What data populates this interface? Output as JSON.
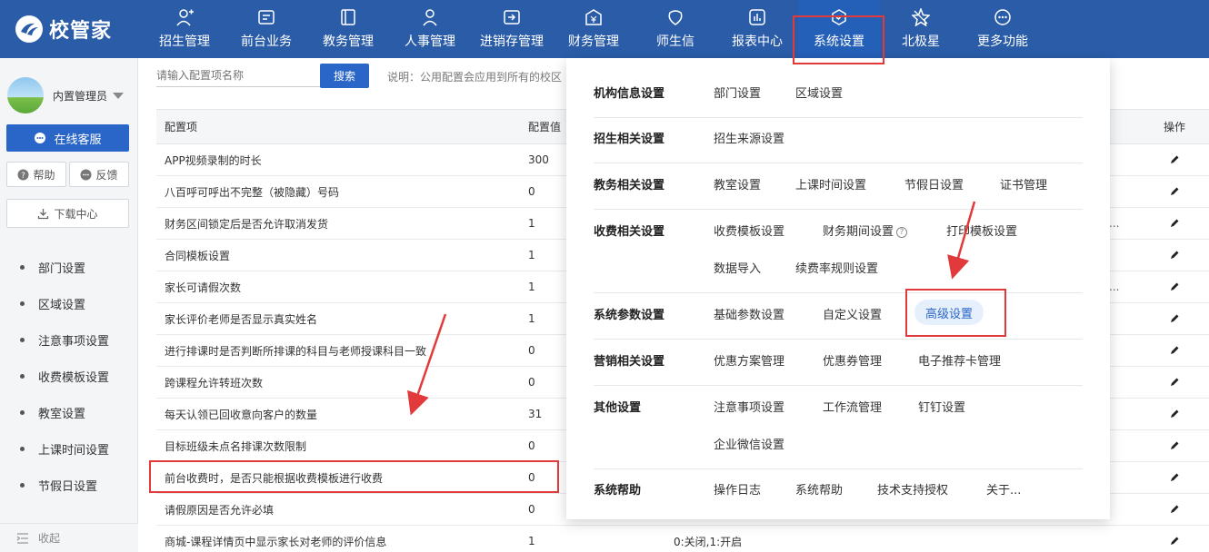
{
  "app": {
    "brand": "校管家"
  },
  "nav": [
    {
      "label": "招生管理",
      "icon": "user-add-icon"
    },
    {
      "label": "前台业务",
      "icon": "reception-icon"
    },
    {
      "label": "教务管理",
      "icon": "book-icon"
    },
    {
      "label": "人事管理",
      "icon": "person-icon"
    },
    {
      "label": "进销存管理",
      "icon": "inventory-icon"
    },
    {
      "label": "财务管理",
      "icon": "finance-icon"
    },
    {
      "label": "师生信",
      "icon": "message-icon"
    },
    {
      "label": "报表中心",
      "icon": "report-icon"
    },
    {
      "label": "系统设置",
      "icon": "settings-icon",
      "active": true
    },
    {
      "label": "北极星",
      "icon": "star-icon"
    },
    {
      "label": "更多功能",
      "icon": "more-icon"
    }
  ],
  "sidebar": {
    "username": "内置管理员",
    "online_service": "在线客服",
    "help": "帮助",
    "feedback": "反馈",
    "download": "下载中心",
    "items": [
      "部门设置",
      "区域设置",
      "注意事项设置",
      "收费模板设置",
      "教室设置",
      "上课时间设置",
      "节假日设置"
    ],
    "collapse": "收起"
  },
  "search": {
    "placeholder": "请输入配置项名称",
    "button": "搜索",
    "note": "说明：公用配置会应用到所有的校区"
  },
  "table": {
    "headers": {
      "name": "配置项",
      "value": "配置值",
      "op": "操作"
    },
    "rows": [
      {
        "name": "APP视频录制的时长",
        "value": "300",
        "desc": "",
        "extra": ""
      },
      {
        "name": "八百呼可呼出不完整（被隐藏）号码",
        "value": "0",
        "desc": "",
        "extra": ""
      },
      {
        "name": "财务区间锁定后是否允许取消发货",
        "value": "1",
        "desc": "",
        "extra": "..."
      },
      {
        "name": "合同模板设置",
        "value": "1",
        "desc": "",
        "extra": ""
      },
      {
        "name": "家长可请假次数",
        "value": "1",
        "desc": "",
        "extra": "..."
      },
      {
        "name": "家长评价老师是否显示真实姓名",
        "value": "1",
        "desc": "",
        "extra": ""
      },
      {
        "name": "进行排课时是否判断所排课的科目与老师授课科目一致",
        "value": "0",
        "desc": "",
        "extra": ""
      },
      {
        "name": "跨课程允许转班次数",
        "value": "0",
        "desc": "",
        "extra": ""
      },
      {
        "name": "每天认领已回收意向客户的数量",
        "value": "31",
        "desc": "",
        "extra": ""
      },
      {
        "name": "目标班级未点名排课次数限制",
        "value": "0",
        "desc": "",
        "extra": ""
      },
      {
        "name": "前台收费时，是否只能根据收费模板进行收费",
        "value": "0",
        "desc": "",
        "extra": ""
      },
      {
        "name": "请假原因是否允许必填",
        "value": "0",
        "desc": "",
        "extra": ""
      },
      {
        "name": "商城-课程详情页中显示家长对老师的评价信息",
        "value": "1",
        "desc": "0:关闭,1:开启",
        "extra": ""
      }
    ]
  },
  "dropdown": {
    "sections": [
      {
        "title": "机构信息设置",
        "links": [
          "部门设置",
          "区域设置"
        ]
      },
      {
        "title": "招生相关设置",
        "links": [
          "招生来源设置"
        ]
      },
      {
        "title": "教务相关设置",
        "links": [
          "教室设置",
          "上课时间设置",
          "节假日设置",
          "证书管理"
        ]
      },
      {
        "title": "收费相关设置",
        "links": [
          "收费模板设置",
          "财务期间设置",
          "打印模板设置",
          "数据导入",
          "续费率规则设置"
        ]
      },
      {
        "title": "系统参数设置",
        "links": [
          "基础参数设置",
          "自定义设置",
          "高级设置"
        ]
      },
      {
        "title": "营销相关设置",
        "links": [
          "优惠方案管理",
          "优惠券管理",
          "电子推荐卡管理"
        ]
      },
      {
        "title": "其他设置",
        "links": [
          "注意事项设置",
          "工作流管理",
          "钉钉设置",
          "企业微信设置"
        ]
      },
      {
        "title": "系统帮助",
        "links": [
          "操作日志",
          "系统帮助",
          "技术支持授权",
          "关于..."
        ]
      }
    ]
  },
  "colors": {
    "nav_bg": "#2a5ca8",
    "accent": "#2a66c7",
    "highlight_box": "#e23a3a"
  }
}
